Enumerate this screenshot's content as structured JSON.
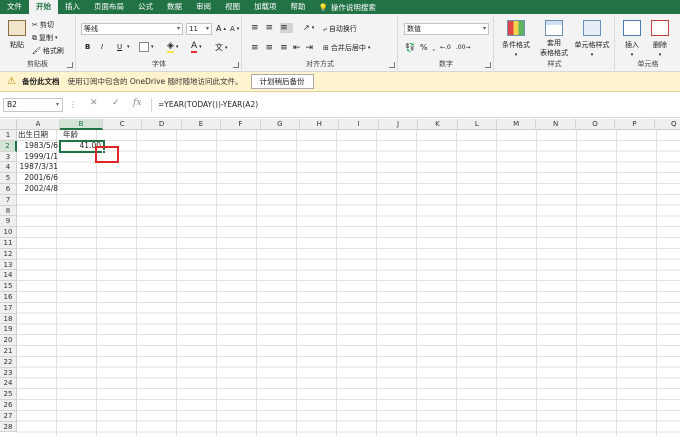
{
  "menu": {
    "tabs": [
      "文件",
      "开始",
      "插入",
      "页面布局",
      "公式",
      "数据",
      "审阅",
      "视图",
      "加载项",
      "帮助"
    ],
    "active_index": 1,
    "tellme": "操作说明搜索"
  },
  "ribbon": {
    "clipboard": {
      "paste": "粘贴",
      "cut": "剪切",
      "copy": "复制",
      "format_painter": "格式刷",
      "label": "剪贴板"
    },
    "font": {
      "font_name": "等线",
      "font_size": "11",
      "bold": "B",
      "italic": "I",
      "underline": "U",
      "font_color": "A",
      "label": "字体"
    },
    "alignment": {
      "wrap_text": "自动换行",
      "merge_center": "合并后居中",
      "label": "对齐方式"
    },
    "number": {
      "format": "数值",
      "label": "数字"
    },
    "styles": {
      "conditional": "条件格式",
      "table_line1": "套用",
      "table_line2": "表格格式",
      "cell_styles": "单元格样式",
      "label": "样式"
    },
    "cells": {
      "insert": "插入",
      "delete": "删除",
      "label": "单元格"
    }
  },
  "warning": {
    "title": "备份此文档",
    "message": "使用订阅中包含的 OneDrive 随时随地访问此文件。",
    "button": "计划稍后备份"
  },
  "formula_bar": {
    "name_box": "B2",
    "cancel": "✕",
    "enter": "✓",
    "fx": "fx",
    "formula": "=YEAR(TODAY())-YEAR(A2)"
  },
  "sheet": {
    "columns": [
      "A",
      "B",
      "C",
      "D",
      "E",
      "F",
      "G",
      "H",
      "I",
      "J",
      "K",
      "L",
      "M",
      "N",
      "O",
      "P",
      "Q"
    ],
    "rows": [
      "1",
      "2",
      "3",
      "4",
      "5",
      "6",
      "7",
      "8",
      "9",
      "10",
      "11",
      "12",
      "13",
      "14",
      "15",
      "16",
      "17",
      "18",
      "19",
      "20",
      "21",
      "22",
      "23",
      "24",
      "25",
      "26",
      "27",
      "28"
    ],
    "cells": {
      "A1": "出生日期",
      "B1": "年龄",
      "A2": "1983/5/6",
      "B2": "41.00",
      "A3": "1999/1/1",
      "A4": "1987/3/31",
      "A5": "2001/6/6",
      "A6": "2002/4/8"
    }
  }
}
